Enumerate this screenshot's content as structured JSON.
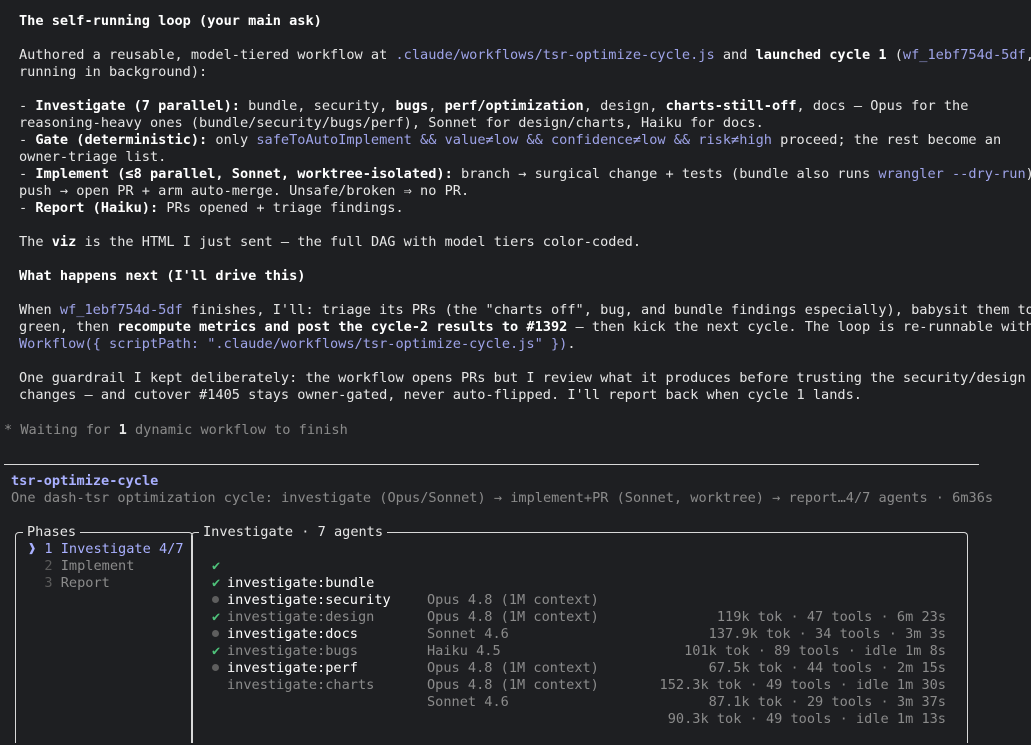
{
  "summary": {
    "heading": "The self-running loop (your main ask)",
    "p1": {
      "a": "Authored a reusable, model-tiered workflow at ",
      "path": ".claude/workflows/tsr-optimize-cycle.js",
      "b": " and ",
      "launched": "launched cycle 1",
      "c": " (",
      "wfid": "wf_1ebf754d-5df",
      "d": ",",
      "line2": "running in background):"
    },
    "bullets": {
      "inv_label": "Investigate (7 parallel):",
      "inv_a": " bundle, security, ",
      "inv_bugs": "bugs",
      "inv_b": ", ",
      "inv_perf": "perf/optimization",
      "inv_c": ", design, ",
      "inv_charts": "charts-still-off",
      "inv_d": ", docs — Opus for the",
      "inv_line2": "reasoning-heavy ones (bundle/security/bugs/perf), Sonnet for design/charts, Haiku for docs.",
      "gate_label": "Gate (deterministic):",
      "gate_a": " only ",
      "gate_code": "safeToAutoImplement && value≠low && confidence≠low && risk≠high",
      "gate_b": " proceed; the rest become an",
      "gate_line2": "owner-triage list.",
      "impl_label": "Implement (≤8 parallel, Sonnet, worktree-isolated):",
      "impl_a": " branch → surgical change + tests (bundle also runs ",
      "impl_code": "wrangler --dry-run",
      "impl_b": ") →",
      "impl_line2": "push → open PR + arm auto-merge. Unsafe/broken ⇒ no PR.",
      "rep_label": "Report (Haiku):",
      "rep_a": " PRs opened + triage findings."
    },
    "viz": {
      "a": "The ",
      "b": "viz",
      "c": " is the HTML I just sent — the full DAG with model tiers color-coded."
    },
    "next_heading": "What happens next (I'll drive this)",
    "next": {
      "a": "When ",
      "wfid": "wf_1ebf754d-5df",
      "b": " finishes, I'll: triage its PRs (the \"charts off\", bug, and bundle findings especially), babysit them to",
      "c": "green, then ",
      "bold": "recompute metrics and post the cycle-2 results to #1392",
      "d": " — then kick the next cycle. The loop is re-runnable with",
      "code": "Workflow({ scriptPath: \".claude/workflows/tsr-optimize-cycle.js\" })",
      "e": "."
    },
    "guard_line1": "One guardrail I kept deliberately: the workflow opens PRs but I review what it produces before trusting the security/design",
    "guard_line2": "changes — and cutover #1405 stays owner-gated, never auto-flipped. I'll report back when cycle 1 lands."
  },
  "status": {
    "star": "*",
    "a": " Waiting for ",
    "count": "1",
    "b": " dynamic workflow to finish"
  },
  "workflow": {
    "name": "tsr-optimize-cycle",
    "description": "One dash-tsr optimization cycle: investigate (Opus/Sonnet) → implement+PR (Sonnet, worktree) → report…4/7 agents · 6m36s"
  },
  "phases": {
    "title": "Phases",
    "items": [
      {
        "marker": "❱",
        "num": "1",
        "label": "Investigate 4/7"
      },
      {
        "marker": " ",
        "num": "2",
        "label": "Implement"
      },
      {
        "marker": " ",
        "num": "3",
        "label": "Report"
      }
    ]
  },
  "investigate": {
    "title": "Investigate · 7 agents",
    "agents": [
      {
        "name": "investigate:bundle",
        "model": "Opus 4.8 (1M context)",
        "stats": "119k tok · 47 tools · 6m 23s",
        "state": "done"
      },
      {
        "name": "investigate:security",
        "model": "Opus 4.8 (1M context)",
        "stats": "137.9k tok · 34 tools · 3m 3s",
        "state": "done"
      },
      {
        "name": "investigate:design",
        "model": "Sonnet 4.6",
        "stats": "101k tok · 89 tools · idle 1m 8s",
        "state": "idle"
      },
      {
        "name": "investigate:docs",
        "model": "Haiku 4.5",
        "stats": "67.5k tok · 44 tools · 2m 15s",
        "state": "done"
      },
      {
        "name": "investigate:bugs",
        "model": "Opus 4.8 (1M context)",
        "stats": "152.3k tok · 49 tools · idle 1m 30s",
        "state": "idle"
      },
      {
        "name": "investigate:perf",
        "model": "Opus 4.8 (1M context)",
        "stats": "87.1k tok · 29 tools · 3m 37s",
        "state": "done"
      },
      {
        "name": "investigate:charts",
        "model": "Sonnet 4.6",
        "stats": "90.3k tok · 49 tools · idle 1m 13s",
        "state": "idle"
      }
    ],
    "done_icon": "check-icon",
    "idle_icon": "dot-icon"
  },
  "colors": {
    "background": "#1e1f22",
    "accent": "#a9b0ff",
    "code": "#9ea3e8",
    "success": "#4ec27a",
    "muted": "#8b8b8b"
  }
}
